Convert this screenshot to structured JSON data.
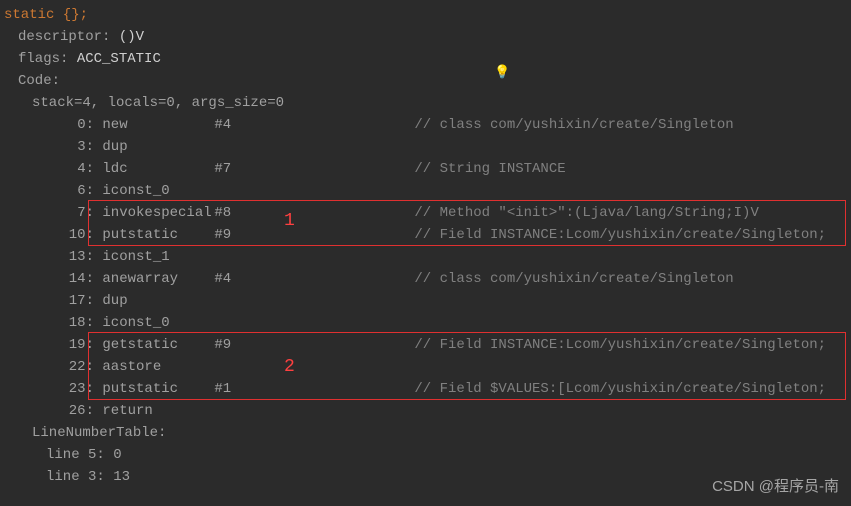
{
  "header": {
    "line0": "static {};",
    "descriptor_label": "descriptor:",
    "descriptor_value": "()V",
    "flags_label": "flags:",
    "flags_value": "ACC_STATIC",
    "code_label": "Code:",
    "stack_line": "stack=4, locals=0, args_size=0"
  },
  "instr": [
    {
      "off": "0:",
      "op": "new",
      "ref": "#4",
      "cmt": "// class com/yushixin/create/Singleton"
    },
    {
      "off": "3:",
      "op": "dup",
      "ref": "",
      "cmt": ""
    },
    {
      "off": "4:",
      "op": "ldc",
      "ref": "#7",
      "cmt": "// String INSTANCE"
    },
    {
      "off": "6:",
      "op": "iconst_0",
      "ref": "",
      "cmt": ""
    },
    {
      "off": "7:",
      "op": "invokespecial",
      "ref": "#8",
      "cmt": "// Method \"<init>\":(Ljava/lang/String;I)V"
    },
    {
      "off": "10:",
      "op": "putstatic",
      "ref": "#9",
      "cmt": "// Field INSTANCE:Lcom/yushixin/create/Singleton;"
    },
    {
      "off": "13:",
      "op": "iconst_1",
      "ref": "",
      "cmt": ""
    },
    {
      "off": "14:",
      "op": "anewarray",
      "ref": "#4",
      "cmt": "// class com/yushixin/create/Singleton"
    },
    {
      "off": "17:",
      "op": "dup",
      "ref": "",
      "cmt": ""
    },
    {
      "off": "18:",
      "op": "iconst_0",
      "ref": "",
      "cmt": ""
    },
    {
      "off": "19:",
      "op": "getstatic",
      "ref": "#9",
      "cmt": "// Field INSTANCE:Lcom/yushixin/create/Singleton;"
    },
    {
      "off": "22:",
      "op": "aastore",
      "ref": "",
      "cmt": ""
    },
    {
      "off": "23:",
      "op": "putstatic",
      "ref": "#1",
      "cmt": "// Field $VALUES:[Lcom/yushixin/create/Singleton;"
    },
    {
      "off": "26:",
      "op": "return",
      "ref": "",
      "cmt": ""
    }
  ],
  "lnt": {
    "label": "LineNumberTable:",
    "lines": [
      "line 5: 0",
      "line 3: 13"
    ]
  },
  "annot": {
    "one": "1",
    "two": "2"
  },
  "watermark": "CSDN @程序员-南"
}
